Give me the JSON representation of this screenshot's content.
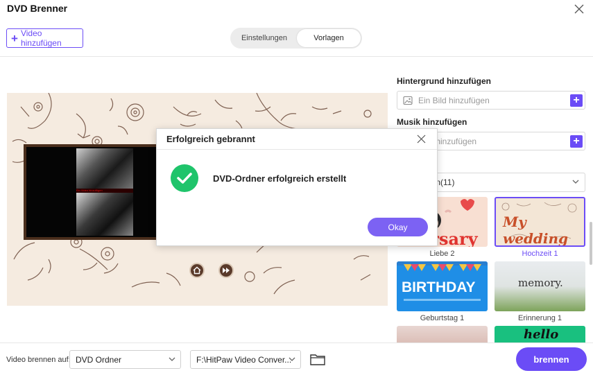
{
  "window": {
    "title": "DVD Brenner"
  },
  "toolbar": {
    "add_video_label": "Video hinzufügen",
    "tabs": [
      {
        "label": "Einstellungen",
        "active": false
      },
      {
        "label": "Vorlagen",
        "active": true
      }
    ]
  },
  "preview": {
    "strip_text": "Ein Video hinzufügen"
  },
  "panel": {
    "background_title": "Hintergrund hinzufügen",
    "background_placeholder": "Ein Bild hinzufügen",
    "music_title": "Musik hinzufügen",
    "music_placeholder": "k hinzufügen",
    "template_filter": "gen(11)",
    "templates": [
      {
        "label": "Liebe 2",
        "caption": "iversary",
        "selected": false
      },
      {
        "label": "Hochzeit 1",
        "caption": "My wedding",
        "selected": true
      },
      {
        "label": "Geburtstag 1",
        "caption": "BIRTHDAY",
        "selected": false
      },
      {
        "label": "Erinnerung 1",
        "caption": "memory.",
        "selected": false
      },
      {
        "label": "",
        "caption": "",
        "selected": false
      },
      {
        "label": "",
        "caption": "hello",
        "selected": false
      }
    ]
  },
  "footer": {
    "burn_to_label": "Video brennen auf:",
    "output_type": "DVD Ordner",
    "output_path": "F:\\HitPaw Video Conver...",
    "burn_label": "brennen"
  },
  "dialog": {
    "title": "Erfolgreich gebrannt",
    "message": "DVD-Ordner erfolgreich erstellt",
    "ok_label": "Okay"
  },
  "colors": {
    "accent": "#6b4cf6",
    "success": "#1fc46b",
    "preview_bg": "#f5ebe0"
  }
}
